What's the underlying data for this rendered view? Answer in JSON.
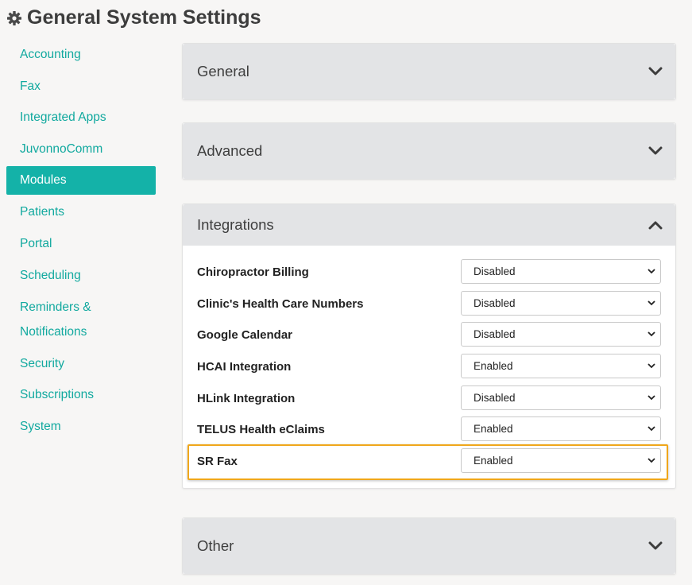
{
  "page_title": "General System Settings",
  "sidebar": {
    "items": [
      {
        "label": "Accounting",
        "active": false
      },
      {
        "label": "Fax",
        "active": false
      },
      {
        "label": "Integrated Apps",
        "active": false
      },
      {
        "label": "JuvonnoComm",
        "active": false
      },
      {
        "label": "Modules",
        "active": true
      },
      {
        "label": "Patients",
        "active": false
      },
      {
        "label": "Portal",
        "active": false
      },
      {
        "label": "Scheduling",
        "active": false
      },
      {
        "label_line1": "Reminders &",
        "label_line2": "Notifications",
        "active": false
      },
      {
        "label": "Security",
        "active": false
      },
      {
        "label": "Subscriptions",
        "active": false
      },
      {
        "label": "System",
        "active": false
      }
    ]
  },
  "sections": {
    "general": {
      "title": "General",
      "expanded": false
    },
    "advanced": {
      "title": "Advanced",
      "expanded": false
    },
    "integrations": {
      "title": "Integrations",
      "expanded": true,
      "rows": [
        {
          "label": "Chiropractor Billing",
          "value": "Disabled"
        },
        {
          "label": "Clinic's Health Care Numbers",
          "value": "Disabled"
        },
        {
          "label": "Google Calendar",
          "value": "Disabled"
        },
        {
          "label": "HCAI Integration",
          "value": "Enabled"
        },
        {
          "label": "HLink Integration",
          "value": "Disabled"
        },
        {
          "label": "TELUS Health eClaims",
          "value": "Enabled"
        },
        {
          "label": "SR Fax",
          "value": "Enabled",
          "highlighted": true
        }
      ]
    },
    "other": {
      "title": "Other",
      "expanded": false
    }
  },
  "colors": {
    "accent": "#14b2a8",
    "link": "#12a99f",
    "highlight": "#f0a71b",
    "panel_header": "#e3e4e6"
  },
  "icons": {
    "title": "gear-icon",
    "collapsed": "chevron-down-icon",
    "expanded": "chevron-up-icon",
    "select": "caret-down-icon"
  }
}
